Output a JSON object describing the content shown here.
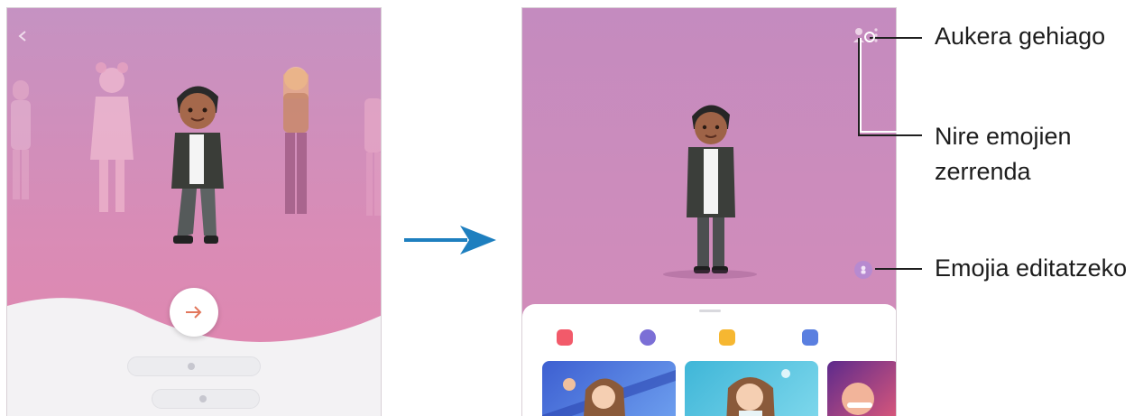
{
  "left_screen": {
    "avatar_name": "",
    "create_button_label": "",
    "link_button_label": "",
    "next_icon": "arrow-right-icon"
  },
  "right_screen": {
    "header_title": "",
    "tabs": [
      {
        "label": "",
        "icon": "video-icon",
        "color": "#f25a6a"
      },
      {
        "label": "",
        "icon": "figure-icon",
        "color": "#7b6fd6"
      },
      {
        "label": "",
        "icon": "sticker-icon",
        "color": "#f6b731"
      },
      {
        "label": "",
        "icon": "camera-icon",
        "color": "#5a7fe0"
      }
    ]
  },
  "callouts": {
    "more_options": "Aukera gehiago",
    "emoji_list_line1": "Nire emojien",
    "emoji_list_line2": "zerrenda",
    "edit_emoji": "Emojia editatzeko"
  },
  "colors": {
    "arrow": "#1e7fbf",
    "screen_pink": "#d98cb6",
    "accent_orange": "#e2775c"
  }
}
